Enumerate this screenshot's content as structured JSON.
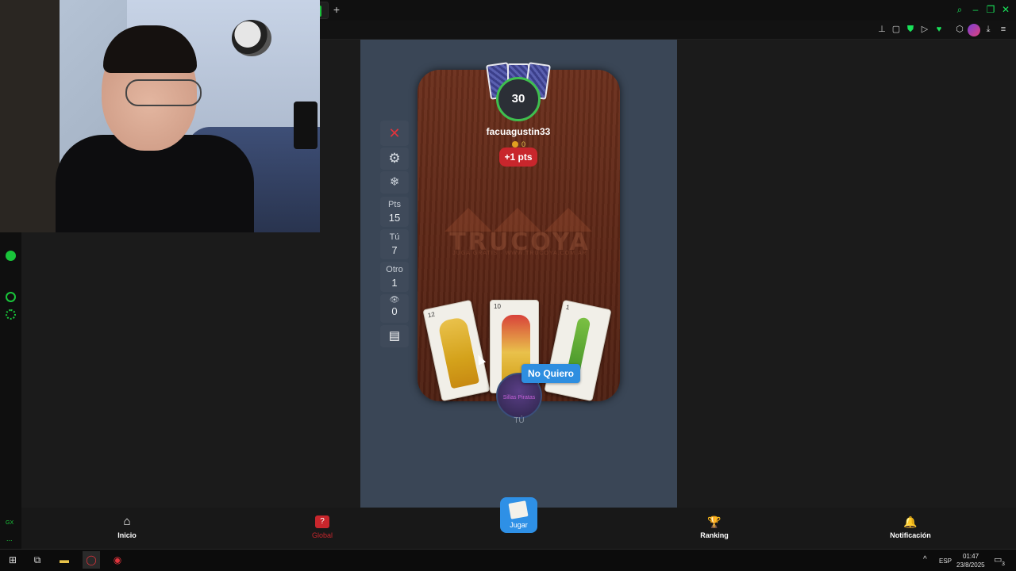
{
  "browser": {
    "new_tab": "+",
    "window_controls": [
      "⌕",
      "–",
      "❐",
      "✕"
    ],
    "toolbar_icons": [
      "pin-icon",
      "snapshot-icon",
      "shield-icon",
      "play-icon",
      "heart-icon",
      "extensions-icon",
      "profile-icon",
      "download-icon",
      "menu-icon"
    ],
    "accent_color": "#19e35a"
  },
  "game": {
    "sidebar": {
      "close_symbol": "✕",
      "pts_label": "Pts",
      "pts_value": "15",
      "tu_label": "Tú",
      "tu_value": "7",
      "otro_label": "Otro",
      "otro_value": "1",
      "viewers_value": "0"
    },
    "opponent": {
      "timer": "30",
      "name": "facuagustin33",
      "coins": "0",
      "badge": "+1 pts"
    },
    "logo": {
      "title": "TRUCOYA",
      "subtitle": "JUGÁ GRATIS · WWW.TRUCOYA.COM.AR"
    },
    "player": {
      "cards": [
        {
          "number": "12",
          "suit": "oro"
        },
        {
          "number": "10",
          "suit": "oro"
        },
        {
          "number": "1",
          "suit": "basto"
        }
      ],
      "avatar_text": "Sillas Piratas",
      "label": "TÚ"
    },
    "action_button": "No Quiero"
  },
  "bottom_nav": {
    "inicio": "Inicio",
    "global": "Global",
    "jugar": "Jugar",
    "ranking": "Ranking",
    "notificacion": "Notificación"
  },
  "taskbar": {
    "lang": "ESP",
    "time": "01:47",
    "date": "23/8/2025",
    "notifications": "3"
  },
  "gx_sidebar": {
    "label": "GX",
    "more": "..."
  }
}
